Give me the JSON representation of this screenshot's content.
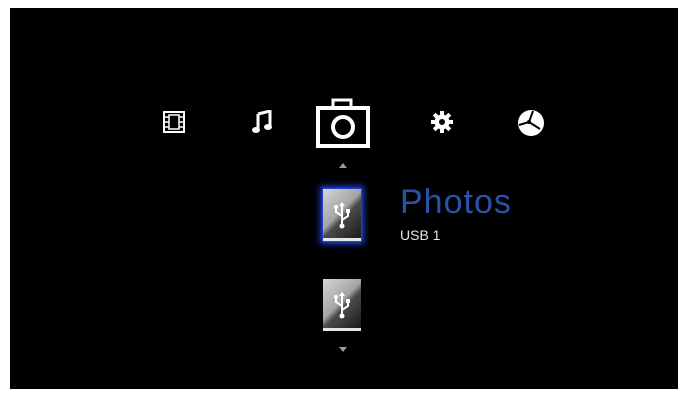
{
  "menu": {
    "categories": [
      {
        "id": "video",
        "icon": "film-icon",
        "selected": false
      },
      {
        "id": "music",
        "icon": "music-note-icon",
        "selected": false
      },
      {
        "id": "photos",
        "icon": "camera-icon",
        "selected": true
      },
      {
        "id": "settings",
        "icon": "gear-icon",
        "selected": false
      },
      {
        "id": "network",
        "icon": "globe-icon",
        "selected": false
      }
    ]
  },
  "selection": {
    "title": "Photos",
    "source": "USB 1"
  },
  "devices": [
    {
      "icon": "usb-icon",
      "selected": true
    },
    {
      "icon": "usb-icon",
      "selected": false
    }
  ],
  "colors": {
    "background": "#000000",
    "title": "#2a52a8",
    "highlight_glow": "#1f3fd0"
  }
}
